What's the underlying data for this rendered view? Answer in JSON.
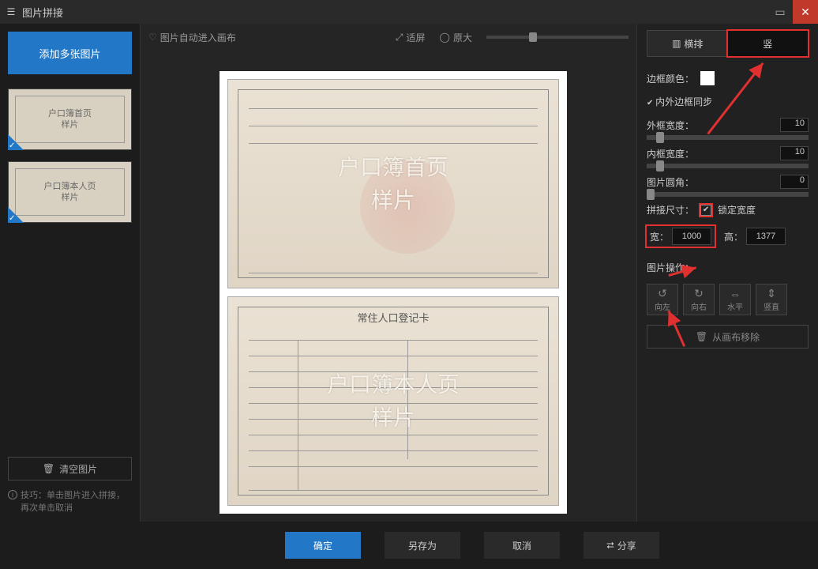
{
  "window": {
    "title": "图片拼接"
  },
  "left": {
    "add_button": "添加多张图片",
    "thumb1": "户口簿首页\n样片",
    "thumb2": "户口簿本人页\n样片",
    "clear": "清空图片",
    "tip": "技巧：单击图片进入拼接，再次单击取消"
  },
  "center_toolbar": {
    "auto_canvas": "图片自动进入画布",
    "fit": "适屏",
    "original": "原大"
  },
  "canvas": {
    "card1_overlay": "户口簿首页\n样片",
    "card2_title": "常住人口登记卡",
    "card2_overlay": "户口簿本人页\n样片"
  },
  "right": {
    "layout_h": "横排",
    "layout_v": "竖",
    "border_color": "边框颜色：",
    "sync": "内外边框同步",
    "outer_width_label": "外框宽度：",
    "outer_width": "10",
    "inner_width_label": "内框宽度：",
    "inner_width": "10",
    "radius_label": "图片圆角：",
    "radius": "0",
    "size_label": "拼接尺寸：",
    "size_lock": "锁定宽度",
    "width_label": "宽：",
    "width_value": "1000",
    "height_label": "高：",
    "height_value": "1377",
    "ops_label": "图片操作：",
    "op_rotate_left": "向左",
    "op_rotate_right": "向右",
    "op_flip_h": "水平",
    "op_flip_v": "竖直",
    "remove": "从画布移除"
  },
  "footer": {
    "ok": "确定",
    "save_as": "另存为",
    "cancel": "取消",
    "share": "分享"
  }
}
